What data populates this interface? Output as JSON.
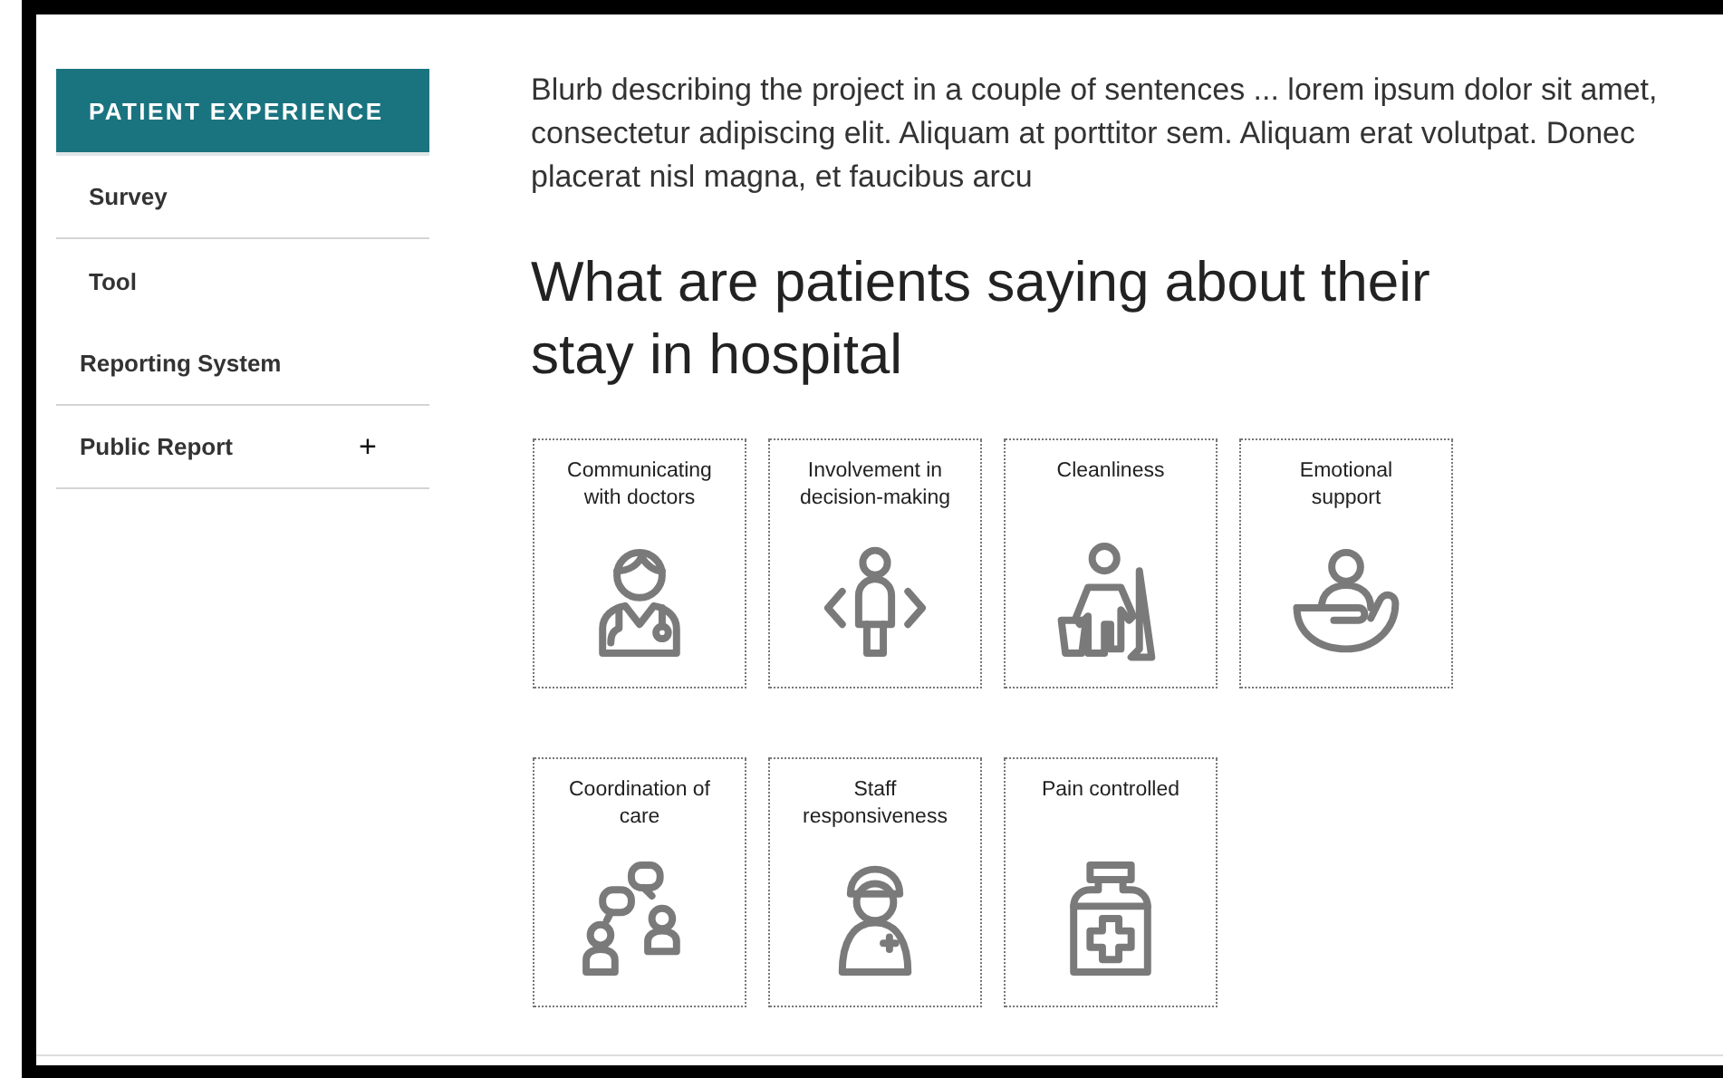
{
  "sidebar": {
    "heading": "PATIENT EXPERIENCE",
    "items": [
      {
        "label": "Survey",
        "kind": "sub",
        "divider": true
      },
      {
        "label": "Tool",
        "kind": "sub",
        "divider": false
      },
      {
        "label": "Reporting System",
        "kind": "main",
        "divider": true
      },
      {
        "label": "Public Report",
        "kind": "main",
        "divider": true,
        "toggle": "+"
      }
    ]
  },
  "intro": "Blurb describing the project in a couple of sentences ... lorem ipsum dolor sit amet, consectetur adipiscing elit. Aliquam at porttitor sem.  Aliquam erat volutpat. Donec placerat nisl magna, et faucibus arcu",
  "heading": "What are patients saying about their stay in hospital",
  "tiles": [
    {
      "title": "Communicating with doctors"
    },
    {
      "title": "Involvement in decision-making"
    },
    {
      "title": "Cleanliness"
    },
    {
      "title": "Emotional support"
    },
    {
      "title": "Coordination of care"
    },
    {
      "title": "Staff responsiveness"
    },
    {
      "title": "Pain controlled"
    }
  ]
}
